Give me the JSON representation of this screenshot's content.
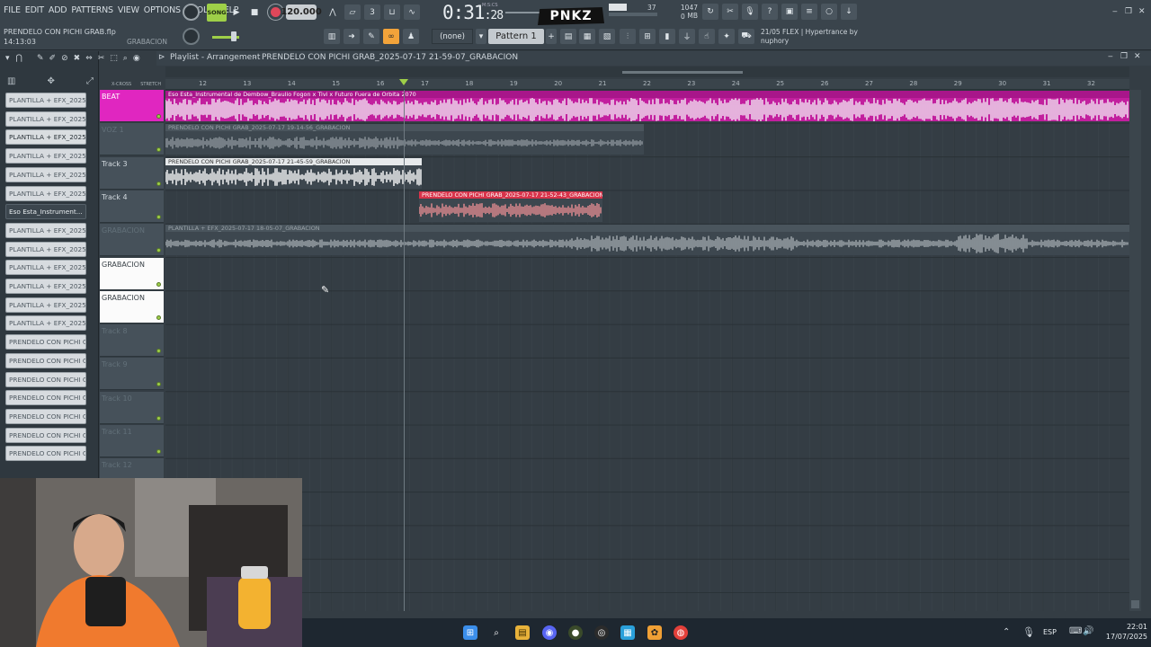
{
  "menu": [
    "FILE",
    "EDIT",
    "ADD",
    "PATTERNS",
    "VIEW",
    "OPTIONS",
    "TOOLS",
    "HELP"
  ],
  "song": {
    "name": "PRENDELO CON PICHI GRAB.flp",
    "time": "14:13:03",
    "tag": "GRABACION"
  },
  "transport": {
    "mode": "SONG",
    "tempo": "120.000",
    "clock_main": "0:31",
    "clock_sub": ":28",
    "clock_unit": "M:S:CS"
  },
  "logo": "PNKZ",
  "meters": {
    "cpu": "37",
    "mem": "1047 MB",
    "poly": "0"
  },
  "snap": "(none)",
  "pattern": "Pattern 1",
  "plugin": {
    "line1": "21/05  FLEX | Hypertrance by",
    "line2": "nuphory"
  },
  "playlist": {
    "title": "Playlist - Arrangement",
    "arrangement": "PRENDELO CON PICHI GRAB_2025-07-17 21-59-07_GRABACION"
  },
  "ruler": [
    "12",
    "13",
    "14",
    "15",
    "16",
    "17",
    "18",
    "19",
    "20",
    "21",
    "22",
    "23",
    "24",
    "25",
    "26",
    "27",
    "28",
    "29",
    "30",
    "31",
    "32"
  ],
  "browser": [
    {
      "label": "PLANTILLA + EFX_2025-0...",
      "style": "normal"
    },
    {
      "label": "PLANTILLA + EFX_2025-0...",
      "style": "normal"
    },
    {
      "label": "PLANTILLA + EFX_2025-0...",
      "style": "sel"
    },
    {
      "label": "PLANTILLA + EFX_2025-0...",
      "style": "normal"
    },
    {
      "label": "PLANTILLA + EFX_2025-0...",
      "style": "normal"
    },
    {
      "label": "PLANTILLA + EFX_2025-0...",
      "style": "normal"
    },
    {
      "label": "Eso Esta_Instrument...",
      "style": "dark"
    },
    {
      "label": "PLANTILLA + EFX_2025-0...",
      "style": "normal"
    },
    {
      "label": "PLANTILLA + EFX_2025-0...",
      "style": "normal"
    },
    {
      "label": "PLANTILLA + EFX_2025-0...",
      "style": "normal"
    },
    {
      "label": "PLANTILLA + EFX_2025-0...",
      "style": "normal"
    },
    {
      "label": "PLANTILLA + EFX_2025-0...",
      "style": "normal"
    },
    {
      "label": "PLANTILLA + EFX_2025-0...",
      "style": "normal"
    },
    {
      "label": "PRENDELO CON PICHI GRA...",
      "style": "normal"
    },
    {
      "label": "PRENDELO CON PICHI GRA...",
      "style": "normal"
    },
    {
      "label": "PRENDELO CON PICHI GRA...",
      "style": "normal"
    },
    {
      "label": "PRENDELO CON PICHI GRA...",
      "style": "normal"
    },
    {
      "label": "PRENDELO CON PICHI GRA...",
      "style": "normal"
    },
    {
      "label": "PRENDELO CON PICHI GRA...",
      "style": "normal"
    },
    {
      "label": "PRENDELO CON PICHI GRA...",
      "style": "normal"
    }
  ],
  "tracks": [
    {
      "name": "BEAT",
      "style": "beat"
    },
    {
      "name": "VOZ 1",
      "style": "dim"
    },
    {
      "name": "Track 3",
      "style": "normal"
    },
    {
      "name": "Track 4",
      "style": "normal"
    },
    {
      "name": "GRABACION",
      "style": "dim"
    },
    {
      "name": "GRABACION",
      "style": "lt"
    },
    {
      "name": "GRABACION",
      "style": "lt"
    },
    {
      "name": "Track 8",
      "style": "dim"
    },
    {
      "name": "Track 9",
      "style": "dim"
    },
    {
      "name": "Track 10",
      "style": "dim"
    },
    {
      "name": "Track 11",
      "style": "dim"
    },
    {
      "name": "Track 12",
      "style": "dim"
    }
  ],
  "clips": [
    {
      "label": "Eso Esta_Instrumental de Dembow_Braulio Fogon x Tivi x Futuro Fuera de Orbita 2070",
      "color": "#c21f9e",
      "wave": "#f4f0f6"
    },
    {
      "label": "PRENDELO CON PICHI GRAB_2025-07-17 19-14-56_GRABACION",
      "color": "#3d474f",
      "wave": "#8e979d"
    },
    {
      "label": "PRENDELO CON PICHI GRAB_2025-07-17 21-45-59_GRABACION",
      "color": "#3d474f",
      "wave": "#ffffff"
    },
    {
      "label": "PRENDELO CON PICHI GRAB_2025-07-17 21-52-43_GRABACION",
      "color": "#3d474f",
      "wave": "#e88e92"
    },
    {
      "label": "PLANTILLA + EFX_2025-07-17 18-05-07_GRABACION",
      "color": "#3d474f",
      "wave": "#a3abb0"
    }
  ],
  "taskbar": {
    "lang": "ESP",
    "time": "22:01",
    "date": "17/07/2025"
  }
}
